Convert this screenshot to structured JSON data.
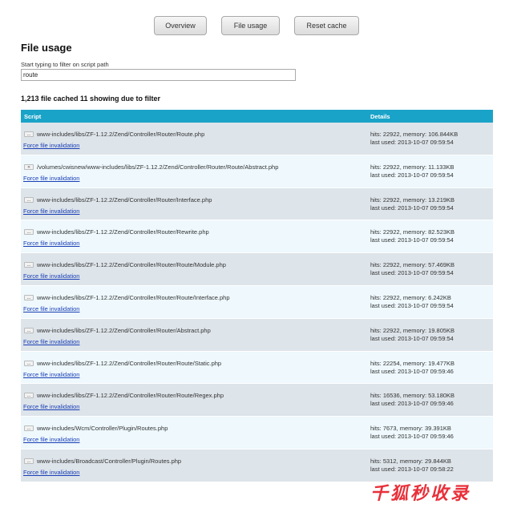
{
  "toolbar": {
    "overview": "Overview",
    "file_usage": "File usage",
    "reset_cache": "Reset cache"
  },
  "page_title": "File usage",
  "filter": {
    "hint": "Start typing to filter on script path",
    "value": "route"
  },
  "summary": "1,213 file cached 11 showing due to filter",
  "table": {
    "headers": {
      "script": "Script",
      "details": "Details"
    },
    "rows": [
      {
        "toggle": "...",
        "path": "www-includes/libs/ZF-1.12.2/Zend/Controller/Router/Route.php",
        "hits": "hits: 22922, memory: 106.844KB",
        "last": "last used: 2013-10-07 09:59:54",
        "action": "Force file invalidation"
      },
      {
        "toggle": "«",
        "path": "/volumes/cwisnew/www-includes/libs/ZF-1.12.2/Zend/Controller/Router/Route/Abstract.php",
        "hits": "hits: 22922, memory: 11.133KB",
        "last": "last used: 2013-10-07 09:59:54",
        "action": "Force file invalidation"
      },
      {
        "toggle": "...",
        "path": "www-includes/libs/ZF-1.12.2/Zend/Controller/Router/Interface.php",
        "hits": "hits: 22922, memory: 13.219KB",
        "last": "last used: 2013-10-07 09:59:54",
        "action": "Force file invalidation"
      },
      {
        "toggle": "...",
        "path": "www-includes/libs/ZF-1.12.2/Zend/Controller/Router/Rewrite.php",
        "hits": "hits: 22922, memory: 82.523KB",
        "last": "last used: 2013-10-07 09:59:54",
        "action": "Force file invalidation"
      },
      {
        "toggle": "...",
        "path": "www-includes/libs/ZF-1.12.2/Zend/Controller/Router/Route/Module.php",
        "hits": "hits: 22922, memory: 57.469KB",
        "last": "last used: 2013-10-07 09:59:54",
        "action": "Force file invalidation"
      },
      {
        "toggle": "...",
        "path": "www-includes/libs/ZF-1.12.2/Zend/Controller/Router/Route/Interface.php",
        "hits": "hits: 22922, memory: 6.242KB",
        "last": "last used: 2013-10-07 09:59:54",
        "action": "Force file invalidation"
      },
      {
        "toggle": "...",
        "path": "www-includes/libs/ZF-1.12.2/Zend/Controller/Router/Abstract.php",
        "hits": "hits: 22922, memory: 19.805KB",
        "last": "last used: 2013-10-07 09:59:54",
        "action": "Force file invalidation"
      },
      {
        "toggle": "...",
        "path": "www-includes/libs/ZF-1.12.2/Zend/Controller/Router/Route/Static.php",
        "hits": "hits: 22254, memory: 19.477KB",
        "last": "last used: 2013-10-07 09:59:46",
        "action": "Force file invalidation"
      },
      {
        "toggle": "...",
        "path": "www-includes/libs/ZF-1.12.2/Zend/Controller/Router/Route/Regex.php",
        "hits": "hits: 16536, memory: 53.180KB",
        "last": "last used: 2013-10-07 09:59:46",
        "action": "Force file invalidation"
      },
      {
        "toggle": "...",
        "path": "www-includes/Wcm/Controller/Plugin/Routes.php",
        "hits": "hits: 7673, memory: 39.391KB",
        "last": "last used: 2013-10-07 09:59:46",
        "action": "Force file invalidation"
      },
      {
        "toggle": "...",
        "path": "www-includes/Broadcast/Controller/Plugin/Routes.php",
        "hits": "hits: 5312, memory: 29.844KB",
        "last": "last used: 2013-10-07 09:58:22",
        "action": "Force file invalidation"
      }
    ]
  },
  "watermark": "千狐秒收录",
  "colors": {
    "header": "#1aa3c8",
    "row_odd": "#dde4ea",
    "row_even": "#eef8fd",
    "link": "#1a3fb5"
  }
}
